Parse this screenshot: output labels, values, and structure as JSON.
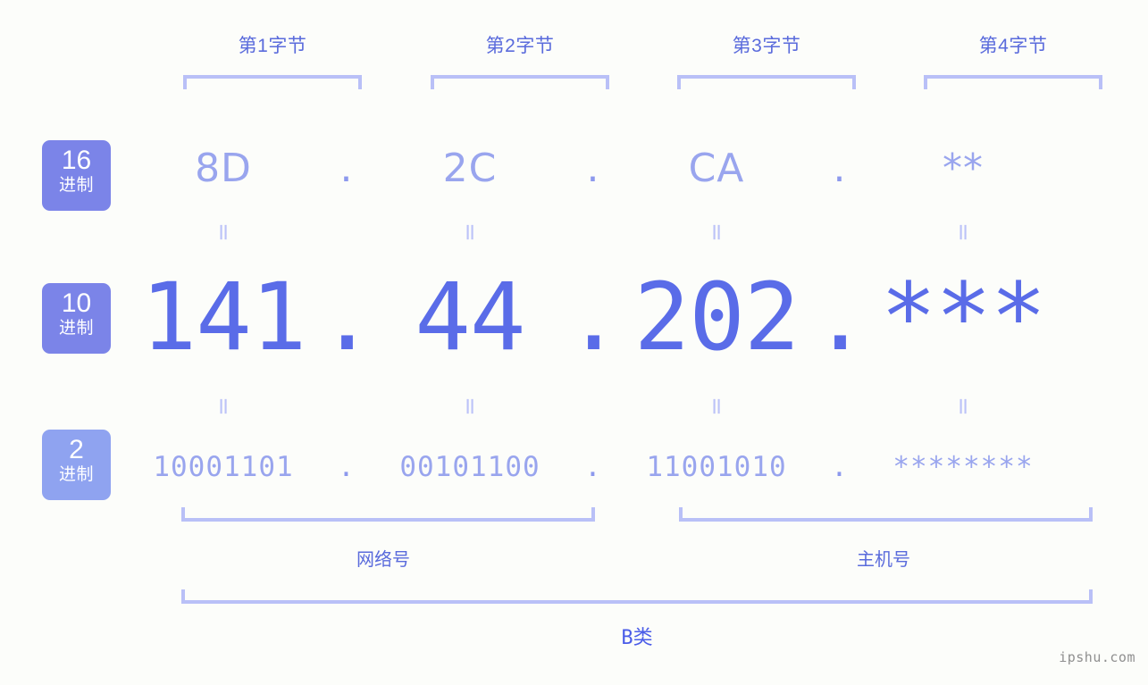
{
  "meta": {
    "background": "#fcfdfa",
    "accent_strong": "#5a6ce8",
    "accent_light": "#99a5ee",
    "bracket_color": "#b9c0f7",
    "badge_color": "#7b84e8",
    "badge_color_light": "#8fa3f0"
  },
  "byte_headers": [
    {
      "label": "第1字节"
    },
    {
      "label": "第2字节"
    },
    {
      "label": "第3字节"
    },
    {
      "label": "第4字节"
    }
  ],
  "bases": [
    {
      "num": "16",
      "zh": "进制"
    },
    {
      "num": "10",
      "zh": "进制"
    },
    {
      "num": "2",
      "zh": "进制"
    }
  ],
  "rows": {
    "hex": {
      "octets": [
        "8D",
        "2C",
        "CA",
        "**"
      ],
      "separator": "."
    },
    "decimal": {
      "octets": [
        "141",
        "44",
        "202",
        "***"
      ],
      "separator": "."
    },
    "binary": {
      "octets": [
        "10001101",
        "00101100",
        "11001010",
        "********"
      ],
      "separator": "."
    }
  },
  "equals": {
    "glyph": "=",
    "row1": [
      "=",
      "=",
      "=",
      "="
    ],
    "row2": [
      "=",
      "=",
      "=",
      "="
    ]
  },
  "parts": [
    {
      "label": "网络号"
    },
    {
      "label": "主机号"
    }
  ],
  "address_class": {
    "label": "B类"
  },
  "watermark": {
    "text": "ipshu.com"
  }
}
